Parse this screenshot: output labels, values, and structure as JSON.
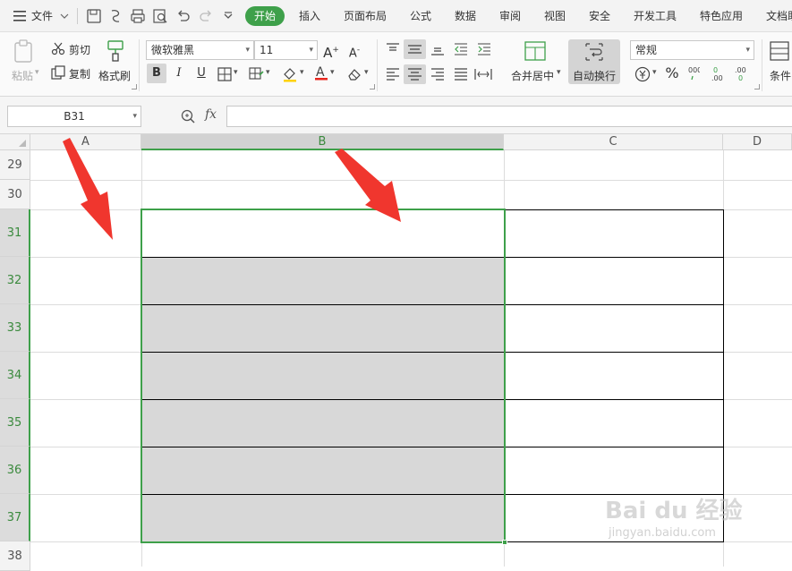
{
  "menubar": {
    "file_label": "文件",
    "tabs": [
      "开始",
      "插入",
      "页面布局",
      "公式",
      "数据",
      "审阅",
      "视图",
      "安全",
      "开发工具",
      "特色应用",
      "文档助"
    ],
    "active_tab": "开始"
  },
  "ribbon": {
    "paste": "粘贴",
    "cut": "剪切",
    "copy": "复制",
    "format_painter": "格式刷",
    "font_name": "微软雅黑",
    "font_size": "11",
    "merge_center": "合并居中",
    "wrap_text": "自动换行",
    "number_format": "常规",
    "conditional": "条件"
  },
  "formula_bar": {
    "name_box": "B31",
    "fx": "fx",
    "content": ""
  },
  "sheet": {
    "columns": [
      "A",
      "B",
      "C",
      "D"
    ],
    "rows": [
      "29",
      "30",
      "31",
      "32",
      "33",
      "34",
      "35",
      "36",
      "37",
      "38"
    ],
    "selected_column": "B",
    "selected_range": "B31:B37"
  },
  "watermark": {
    "brand": "Bai du 经验",
    "url": "jingyan.baidu.com"
  },
  "colors": {
    "accent_green": "#3ea04a",
    "selection_fill": "#d8d8d8",
    "arrow_red": "#f0362e"
  }
}
